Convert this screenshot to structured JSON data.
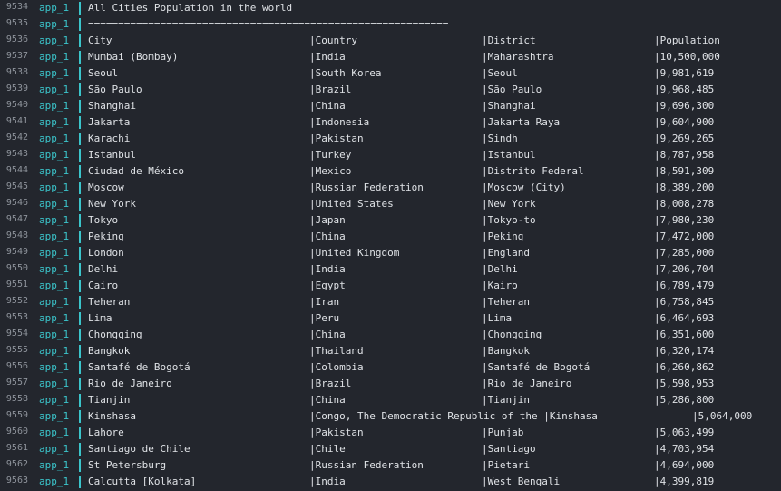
{
  "log": {
    "service": "app_1",
    "title_line": {
      "line_no": "9534",
      "text": "All Cities Population in the world"
    },
    "separator_line": {
      "line_no": "9535",
      "text": "============================================================"
    },
    "header_line": {
      "line_no": "9536",
      "cells": [
        "City",
        "|Country",
        "|District",
        "|Population"
      ]
    },
    "rows": [
      {
        "line_no": "9537",
        "cells": [
          "Mumbai (Bombay)",
          "|India",
          "|Maharashtra",
          "|10,500,000"
        ]
      },
      {
        "line_no": "9538",
        "cells": [
          "Seoul",
          "|South Korea",
          "|Seoul",
          "|9,981,619"
        ]
      },
      {
        "line_no": "9539",
        "cells": [
          "São Paulo",
          "|Brazil",
          "|São Paulo",
          "|9,968,485"
        ]
      },
      {
        "line_no": "9540",
        "cells": [
          "Shanghai",
          "|China",
          "|Shanghai",
          "|9,696,300"
        ]
      },
      {
        "line_no": "9541",
        "cells": [
          "Jakarta",
          "|Indonesia",
          "|Jakarta Raya",
          "|9,604,900"
        ]
      },
      {
        "line_no": "9542",
        "cells": [
          "Karachi",
          "|Pakistan",
          "|Sindh",
          "|9,269,265"
        ]
      },
      {
        "line_no": "9543",
        "cells": [
          "Istanbul",
          "|Turkey",
          "|Istanbul",
          "|8,787,958"
        ]
      },
      {
        "line_no": "9544",
        "cells": [
          "Ciudad de México",
          "|Mexico",
          "|Distrito Federal",
          "|8,591,309"
        ]
      },
      {
        "line_no": "9545",
        "cells": [
          "Moscow",
          "|Russian Federation",
          "|Moscow (City)",
          "|8,389,200"
        ]
      },
      {
        "line_no": "9546",
        "cells": [
          "New York",
          "|United States",
          "|New York",
          "|8,008,278"
        ]
      },
      {
        "line_no": "9547",
        "cells": [
          "Tokyo",
          "|Japan",
          "|Tokyo-to",
          "|7,980,230"
        ]
      },
      {
        "line_no": "9548",
        "cells": [
          "Peking",
          "|China",
          "|Peking",
          "|7,472,000"
        ]
      },
      {
        "line_no": "9549",
        "cells": [
          "London",
          "|United Kingdom",
          "|England",
          "|7,285,000"
        ]
      },
      {
        "line_no": "9550",
        "cells": [
          "Delhi",
          "|India",
          "|Delhi",
          "|7,206,704"
        ]
      },
      {
        "line_no": "9551",
        "cells": [
          "Cairo",
          "|Egypt",
          "|Kairo",
          "|6,789,479"
        ]
      },
      {
        "line_no": "9552",
        "cells": [
          "Teheran",
          "|Iran",
          "|Teheran",
          "|6,758,845"
        ]
      },
      {
        "line_no": "9553",
        "cells": [
          "Lima",
          "|Peru",
          "|Lima",
          "|6,464,693"
        ]
      },
      {
        "line_no": "9554",
        "cells": [
          "Chongqing",
          "|China",
          "|Chongqing",
          "|6,351,600"
        ]
      },
      {
        "line_no": "9555",
        "cells": [
          "Bangkok",
          "|Thailand",
          "|Bangkok",
          "|6,320,174"
        ]
      },
      {
        "line_no": "9556",
        "cells": [
          "Santafé de Bogotá",
          "|Colombia",
          "|Santafé de Bogotá",
          "|6,260,862"
        ]
      },
      {
        "line_no": "9557",
        "cells": [
          "Rio de Janeiro",
          "|Brazil",
          "|Rio de Janeiro",
          "|5,598,953"
        ]
      },
      {
        "line_no": "9558",
        "cells": [
          "Tianjin",
          "|China",
          "|Tianjin",
          "|5,286,800"
        ]
      },
      {
        "line_no": "9559",
        "cells": [
          "Kinshasa",
          "|Congo, The Democratic Republic of the |Kinshasa",
          "",
          "|5,064,000"
        ],
        "overflow": true
      },
      {
        "line_no": "9560",
        "cells": [
          "Lahore",
          "|Pakistan",
          "|Punjab",
          "|5,063,499"
        ]
      },
      {
        "line_no": "9561",
        "cells": [
          "Santiago de Chile",
          "|Chile",
          "|Santiago",
          "|4,703,954"
        ]
      },
      {
        "line_no": "9562",
        "cells": [
          "St Petersburg",
          "|Russian Federation",
          "|Pietari",
          "|4,694,000"
        ]
      },
      {
        "line_no": "9563",
        "cells": [
          "Calcutta [Kolkata]",
          "|India",
          "|West Bengali",
          "|4,399,819"
        ]
      }
    ]
  },
  "colors": {
    "background": "#23262d",
    "service_tag": "#3bc5cb",
    "line_number": "#8f949c",
    "text": "#dfe2e6"
  }
}
